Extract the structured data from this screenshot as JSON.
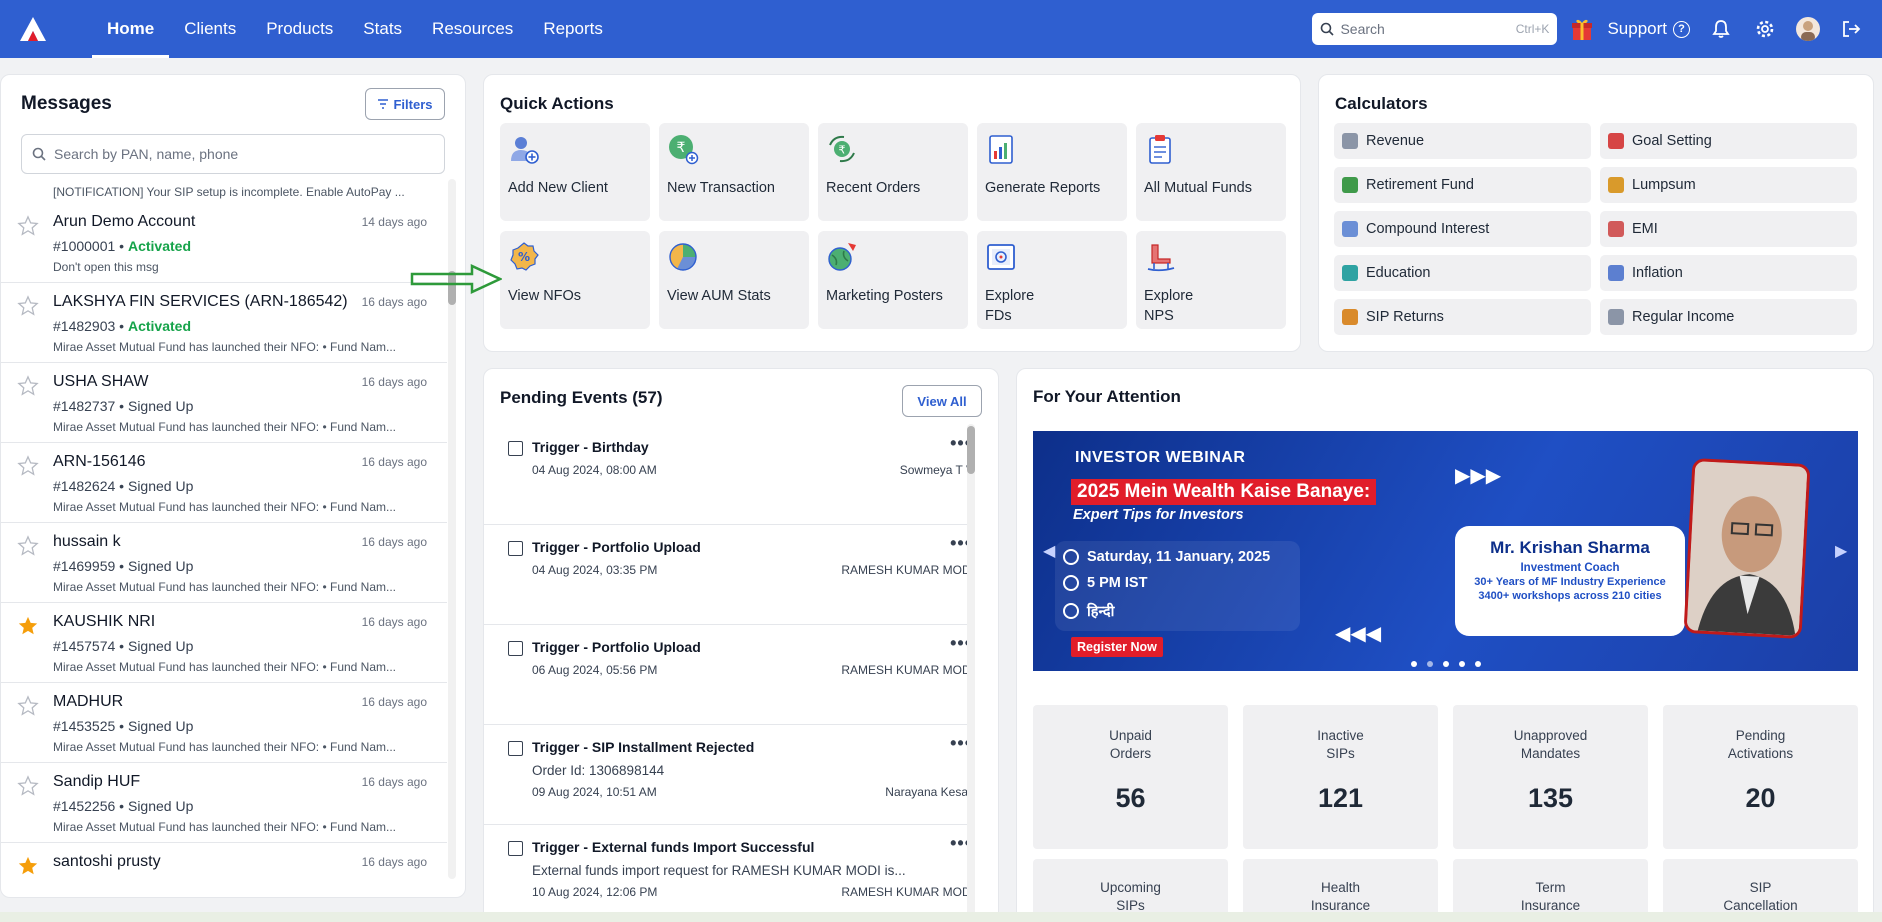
{
  "nav": {
    "items": [
      {
        "label": "Home",
        "active": true
      },
      {
        "label": "Clients"
      },
      {
        "label": "Products"
      },
      {
        "label": "Stats"
      },
      {
        "label": "Resources"
      },
      {
        "label": "Reports"
      }
    ],
    "search_placeholder": "Search",
    "search_shortcut": "Ctrl+K",
    "support_label": "Support",
    "accent": "#2f5fd0"
  },
  "messages": {
    "title": "Messages",
    "filters_label": "Filters",
    "search_placeholder": "Search by PAN, name, phone",
    "notification_line": "[NOTIFICATION] Your SIP setup is incomplete. Enable AutoPay ...",
    "items": [
      {
        "name": "Arun Demo Account",
        "date": "14 days ago",
        "id": "#1000001",
        "status": "Activated",
        "preview": "Don't open this msg",
        "starred": false
      },
      {
        "name": "LAKSHYA FIN SERVICES (ARN-186542)",
        "date": "16 days ago",
        "id": "#1482903",
        "status": "Activated",
        "preview": "Mirae Asset Mutual Fund has launched their NFO: • Fund Nam...",
        "starred": false
      },
      {
        "name": "USHA SHAW",
        "date": "16 days ago",
        "id": "#1482737",
        "status": "Signed Up",
        "preview": "Mirae Asset Mutual Fund has launched their NFO: • Fund Nam...",
        "starred": false
      },
      {
        "name": "ARN-156146",
        "date": "16 days ago",
        "id": "#1482624",
        "status": "Signed Up",
        "preview": "Mirae Asset Mutual Fund has launched their NFO: • Fund Nam...",
        "starred": false
      },
      {
        "name": "hussain k",
        "date": "16 days ago",
        "id": "#1469959",
        "status": "Signed Up",
        "preview": "Mirae Asset Mutual Fund has launched their NFO: • Fund Nam...",
        "starred": false
      },
      {
        "name": "KAUSHIK NRI",
        "date": "16 days ago",
        "id": "#1457574",
        "status": "Signed Up",
        "preview": "Mirae Asset Mutual Fund has launched their NFO: • Fund Nam...",
        "starred": true
      },
      {
        "name": "MADHUR",
        "date": "16 days ago",
        "id": "#1453525",
        "status": "Signed Up",
        "preview": "Mirae Asset Mutual Fund has launched their NFO: • Fund Nam...",
        "starred": false
      },
      {
        "name": "Sandip HUF",
        "date": "16 days ago",
        "id": "#1452256",
        "status": "Signed Up",
        "preview": "Mirae Asset Mutual Fund has launched their NFO: • Fund Nam...",
        "starred": false
      },
      {
        "name": "santoshi prusty",
        "date": "16 days ago",
        "id": "",
        "status": "",
        "preview": "",
        "starred": true
      }
    ]
  },
  "quick_actions": {
    "title": "Quick Actions",
    "tiles": [
      {
        "label": "Add New Client",
        "icon": "add-user-icon"
      },
      {
        "label": "New Transaction",
        "icon": "rupee-icon"
      },
      {
        "label": "Recent Orders",
        "icon": "refresh-rupee-icon"
      },
      {
        "label": "Generate Reports",
        "icon": "report-icon"
      },
      {
        "label": "All Mutual Funds",
        "icon": "clipboard-icon"
      },
      {
        "label": "View NFOs",
        "icon": "percent-badge-icon"
      },
      {
        "label": "View AUM Stats",
        "icon": "pie-chart-icon"
      },
      {
        "label": "Marketing Posters",
        "icon": "globe-rocket-icon"
      },
      {
        "label": "Explore\nFDs",
        "icon": "safe-icon"
      },
      {
        "label": "Explore\nNPS",
        "icon": "rocking-chair-icon"
      }
    ]
  },
  "calculators": {
    "title": "Calculators",
    "items": [
      {
        "label": "Revenue",
        "color": "#8b95a7"
      },
      {
        "label": "Goal Setting",
        "color": "#d64545"
      },
      {
        "label": "Retirement Fund",
        "color": "#3f9a4a"
      },
      {
        "label": "Lumpsum",
        "color": "#d99a2b"
      },
      {
        "label": "Compound Interest",
        "color": "#6b8fd6"
      },
      {
        "label": "EMI",
        "color": "#d15a5a"
      },
      {
        "label": "Education",
        "color": "#2fa3a3"
      },
      {
        "label": "Inflation",
        "color": "#5c7fd0"
      },
      {
        "label": "SIP Returns",
        "color": "#d98a2b"
      },
      {
        "label": "Regular Income",
        "color": "#8b95a7"
      }
    ]
  },
  "pending": {
    "title": "Pending Events (57)",
    "view_all_label": "View All",
    "events": [
      {
        "title": "Trigger - Birthday",
        "sub": "",
        "date": "04 Aug 2024, 08:00 AM",
        "who": "Sowmeya T V"
      },
      {
        "title": "Trigger - Portfolio Upload",
        "sub": "",
        "date": "04 Aug 2024, 03:35 PM",
        "who": "RAMESH KUMAR MODI"
      },
      {
        "title": "Trigger - Portfolio Upload",
        "sub": "",
        "date": "06 Aug 2024, 05:56 PM",
        "who": "RAMESH KUMAR MODI"
      },
      {
        "title": "Trigger - SIP Installment Rejected",
        "sub": "Order Id: 1306898144",
        "date": "09 Aug 2024, 10:51 AM",
        "who": "Narayana Kesav"
      },
      {
        "title": "Trigger - External funds Import Successful",
        "sub": "External funds import request for RAMESH KUMAR MODI is...",
        "date": "10 Aug 2024, 12:06 PM",
        "who": "RAMESH KUMAR MODI"
      }
    ]
  },
  "attention": {
    "title": "For Your Attention",
    "banner": {
      "label": "INVESTOR WEBINAR",
      "headline": "2025 Mein Wealth Kaise Banaye:",
      "subhead": "Expert Tips for Investors",
      "date": "Saturday, 11 January, 2025",
      "time": "5 PM IST",
      "language": "हिन्दी",
      "cta": "Register Now",
      "speaker_name": "Mr. Krishan Sharma",
      "speaker_role": "Investment Coach",
      "speaker_exp1": "30+ Years of MF Industry Experience",
      "speaker_exp2": "3400+ workshops across 210 cities"
    },
    "stats": [
      {
        "label": "Unpaid\nOrders",
        "value": "56"
      },
      {
        "label": "Inactive\nSIPs",
        "value": "121"
      },
      {
        "label": "Unapproved\nMandates",
        "value": "135"
      },
      {
        "label": "Pending\nActivations",
        "value": "20"
      },
      {
        "label": "Upcoming\nSIPs",
        "value": ""
      },
      {
        "label": "Health\nInsurance",
        "value": ""
      },
      {
        "label": "Term\nInsurance",
        "value": ""
      },
      {
        "label": "SIP\nCancellation",
        "value": ""
      }
    ]
  }
}
